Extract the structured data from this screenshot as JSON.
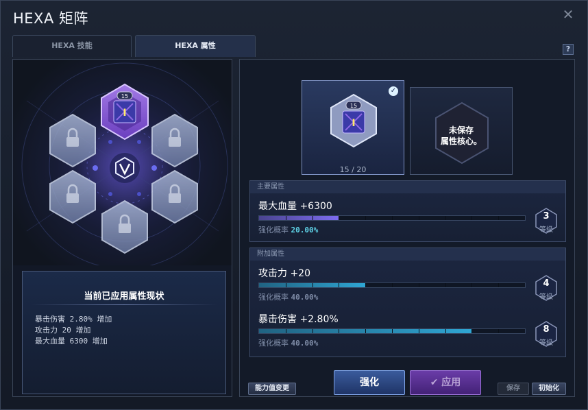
{
  "window": {
    "title": "HEXA 矩阵",
    "close": "✕",
    "help": "?"
  },
  "tabs": [
    {
      "label": "HEXA 技能",
      "active": false
    },
    {
      "label": "HEXA 属性",
      "active": true
    }
  ],
  "matrix": {
    "active_core_level": "15",
    "center_icon": "hexa-v-emblem-icon",
    "locked_slots": 5
  },
  "status": {
    "title": "当前已应用属性现状",
    "lines": [
      "暴击伤害 2.80% 增加",
      "攻击力 20 增加",
      "最大血量 6300 增加"
    ]
  },
  "core": {
    "level": "15",
    "count": "15 / 20",
    "unsaved_line1": "未保存",
    "unsaved_line2": "属性核心。"
  },
  "main_stat": {
    "header": "主要属性",
    "name": "最大血量 +6300",
    "chance_label": "强化概率",
    "chance_value": "20.00%",
    "level": "3",
    "level_word": "等级",
    "progress": 0.3,
    "color": "#7d6cf0"
  },
  "additional": {
    "header": "附加属性",
    "stats": [
      {
        "name": "攻击力 +20",
        "chance_label": "强化概率",
        "chance_value": "40.00%",
        "level": "4",
        "level_word": "等级",
        "progress": 0.4,
        "color": "#2fa6d4"
      },
      {
        "name": "暴击伤害 +2.80%",
        "chance_label": "强化概率",
        "chance_value": "40.00%",
        "level": "8",
        "level_word": "等级",
        "progress": 0.8,
        "color": "#2fa6d4"
      }
    ]
  },
  "buttons": {
    "ability_change": "能力值变更",
    "enhance": "强化",
    "apply": "应用",
    "save": "保存",
    "reset": "初始化"
  },
  "colors": {
    "accent_purple": "#8f5bd8",
    "accent_blue": "#2fa6d4",
    "frame": "#3a4558"
  }
}
